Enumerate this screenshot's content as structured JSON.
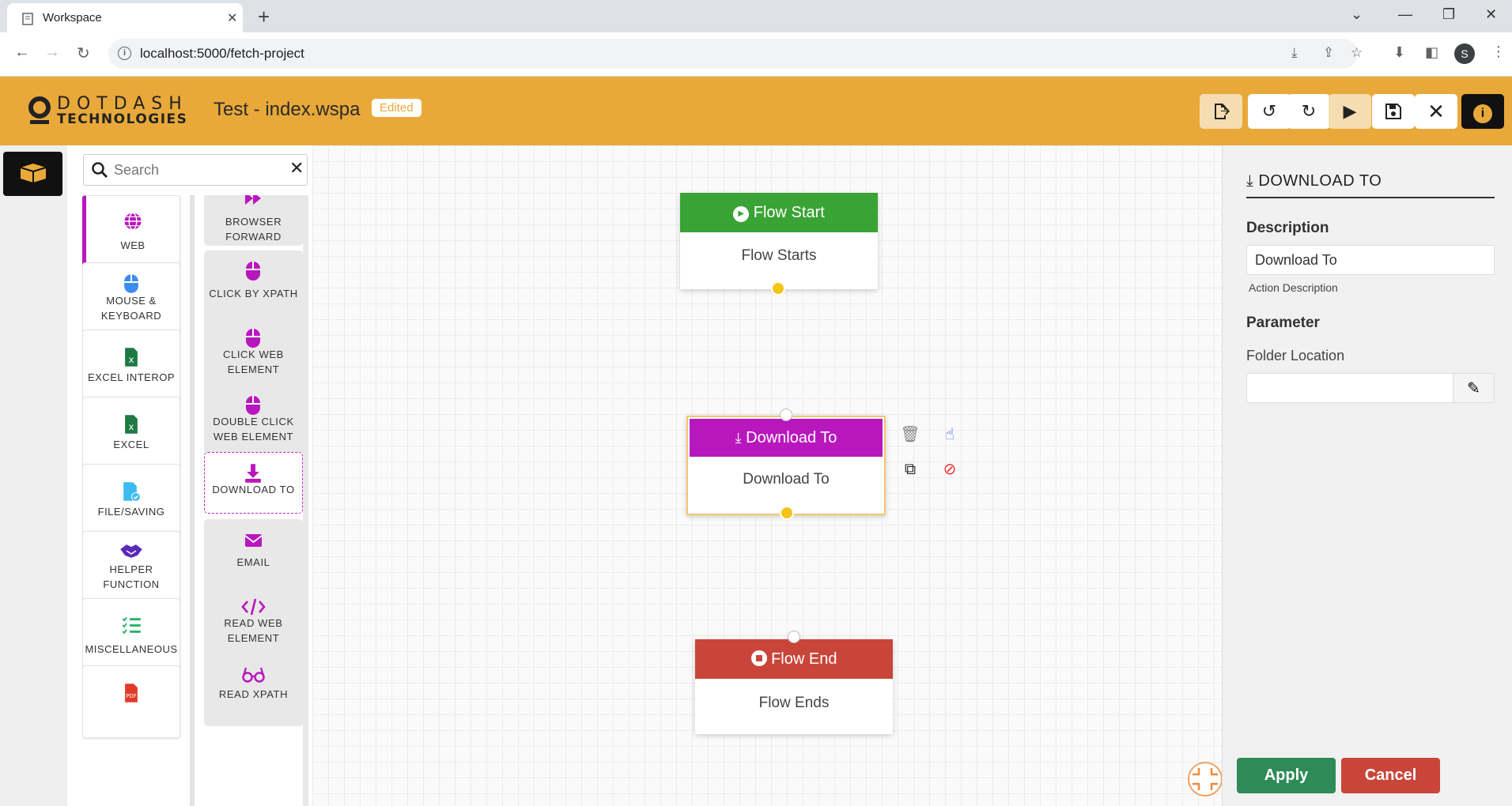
{
  "browser": {
    "tab_title": "Workspace",
    "url": "localhost:5000/fetch-project",
    "profile_initial": "S"
  },
  "header": {
    "logo_line1": "DOTDASH",
    "logo_line2": "TECHNOLOGIES",
    "project_title": "Test - index.wspa",
    "status_badge": "Edited",
    "colors": {
      "header_bg": "#e8a93a"
    }
  },
  "palette": {
    "search_placeholder": "Search",
    "categories": [
      {
        "label": "WEB",
        "icon": "globe-icon",
        "active": true
      },
      {
        "label": "MOUSE & KEYBOARD",
        "icon": "mouse-icon"
      },
      {
        "label": "EXCEL INTEROP",
        "icon": "excel-icon"
      },
      {
        "label": "EXCEL",
        "icon": "excel-icon"
      },
      {
        "label": "FILE/SAVING",
        "icon": "file-icon"
      },
      {
        "label": "HELPER FUNCTION",
        "icon": "handshake-icon"
      },
      {
        "label": "MISCELLANEOUS",
        "icon": "checklist-icon"
      },
      {
        "label": "",
        "icon": "pdf-icon"
      }
    ],
    "actions": [
      {
        "label": "BROWSER FORWARD",
        "icon": "fast-forward-icon"
      },
      {
        "label": "CLICK BY XPATH",
        "icon": "mouse-icon"
      },
      {
        "label": "CLICK WEB ELEMENT",
        "icon": "mouse-icon"
      },
      {
        "label": "DOUBLE CLICK WEB ELEMENT",
        "icon": "mouse-icon"
      },
      {
        "label": "DOWNLOAD TO",
        "icon": "download-icon",
        "selected": true
      },
      {
        "label": "EMAIL",
        "icon": "envelope-icon"
      },
      {
        "label": "READ WEB ELEMENT",
        "icon": "code-icon"
      },
      {
        "label": "READ XPATH",
        "icon": "glasses-icon"
      }
    ]
  },
  "canvas": {
    "nodes": {
      "start": {
        "title": "Flow Start",
        "body": "Flow Starts",
        "color": "#3aa335"
      },
      "download": {
        "title": "Download To",
        "body": "Download To",
        "color": "#b817bd"
      },
      "end": {
        "title": "Flow End",
        "body": "Flow Ends",
        "color": "#c9453a"
      }
    }
  },
  "properties": {
    "title": "DOWNLOAD TO",
    "description_heading": "Description",
    "description_value": "Download To",
    "description_help": "Action Description",
    "parameter_heading": "Parameter",
    "folder_label": "Folder Location",
    "folder_value": "",
    "apply_label": "Apply",
    "cancel_label": "Cancel"
  }
}
